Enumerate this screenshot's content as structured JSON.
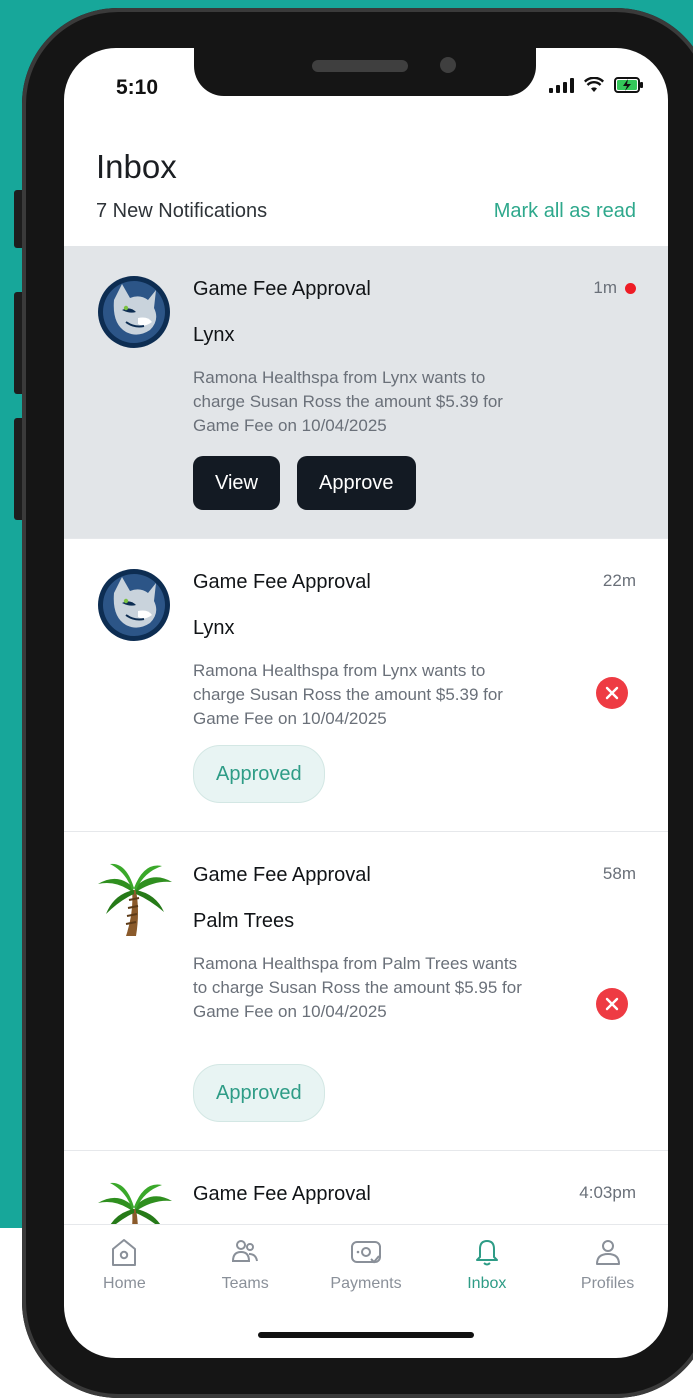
{
  "status_bar": {
    "time": "5:10"
  },
  "header": {
    "title": "Inbox",
    "subtitle": "7 New Notifications",
    "mark_all_label": "Mark all as read"
  },
  "notifications": [
    {
      "title": "Game Fee Approval",
      "team": "Lynx",
      "avatar_icon": "lynx-logo-icon",
      "body": "Ramona Healthspa from Lynx wants to charge Susan Ross the amount $5.39 for Game Fee on 10/04/2025",
      "time": "1m",
      "unread": true,
      "view_label": "View",
      "approve_label": "Approve"
    },
    {
      "title": "Game Fee Approval",
      "team": "Lynx",
      "avatar_icon": "lynx-logo-icon",
      "body": "Ramona Healthspa from Lynx wants to charge Susan Ross the amount $5.39 for Game Fee on 10/04/2025",
      "time": "22m",
      "status": "Approved"
    },
    {
      "title": "Game Fee Approval",
      "team": "Palm Trees",
      "avatar_icon": "palm-tree-icon",
      "body": "Ramona Healthspa from Palm Trees wants to charge Susan Ross the amount $5.95 for Game Fee on 10/04/2025",
      "time": "58m",
      "status": "Approved"
    },
    {
      "title": "Game Fee Approval",
      "avatar_icon": "palm-tree-icon",
      "time": "4:03pm"
    }
  ],
  "tabs": [
    {
      "label": "Home",
      "icon": "home-icon"
    },
    {
      "label": "Teams",
      "icon": "teams-icon"
    },
    {
      "label": "Payments",
      "icon": "payments-icon"
    },
    {
      "label": "Inbox",
      "icon": "bell-icon",
      "active": true
    },
    {
      "label": "Profiles",
      "icon": "profile-icon"
    }
  ],
  "colors": {
    "background": "#17a79a",
    "accent": "#2ea88c",
    "unread_bg": "#e2e5e8",
    "unread_dot": "#ee1c25",
    "reject": "#ee3b43",
    "button_dark": "#131a23"
  }
}
